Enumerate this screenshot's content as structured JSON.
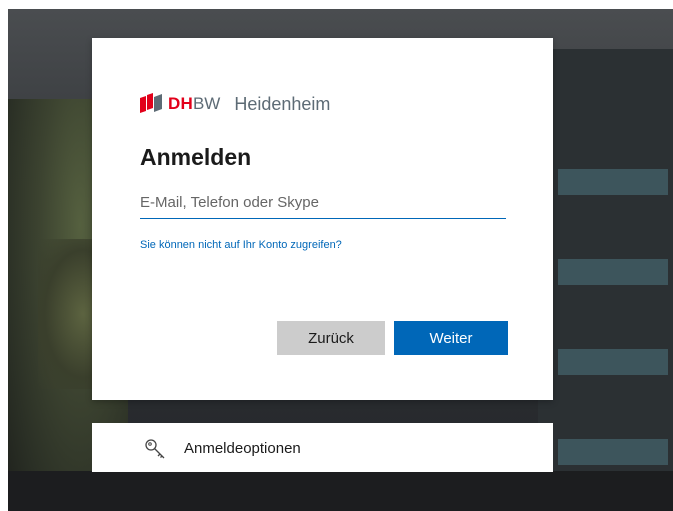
{
  "brand": {
    "logo_primary": "DH",
    "logo_secondary": "BW",
    "location": "Heidenheim",
    "logo_color": "#e2001a"
  },
  "signin": {
    "title": "Anmelden",
    "email_placeholder": "E-Mail, Telefon oder Skype",
    "email_value": "",
    "cant_access_link": "Sie können nicht auf Ihr Konto zugreifen?",
    "back_button": "Zurück",
    "next_button": "Weiter",
    "accent_color": "#0067b8"
  },
  "options": {
    "label": "Anmeldeoptionen",
    "icon": "key-icon"
  }
}
